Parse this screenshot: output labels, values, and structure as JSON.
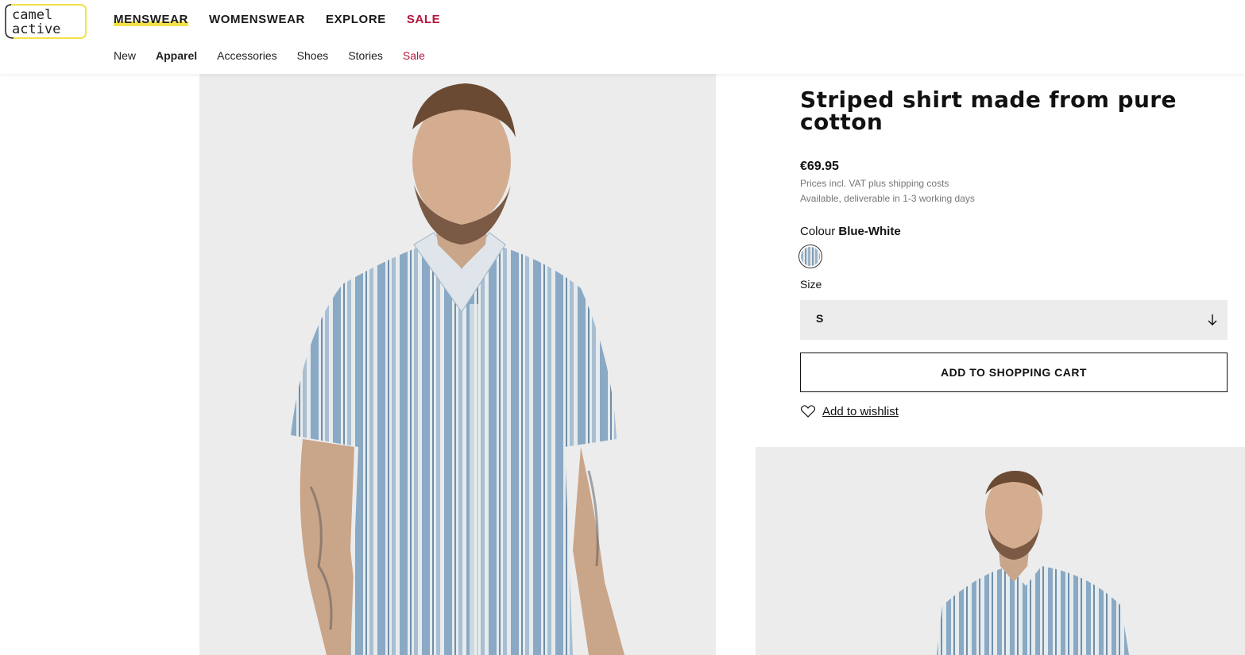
{
  "brand": {
    "logo_line1": "camel",
    "logo_line2": "active",
    "accent": "#f2e24a"
  },
  "main_nav": [
    {
      "label": "MENSWEAR",
      "active": true
    },
    {
      "label": "WOMENSWEAR"
    },
    {
      "label": "EXPLORE"
    },
    {
      "label": "SALE",
      "sale": true
    }
  ],
  "sub_nav": [
    {
      "label": "New"
    },
    {
      "label": "Apparel",
      "active": true
    },
    {
      "label": "Accessories"
    },
    {
      "label": "Shoes"
    },
    {
      "label": "Stories"
    },
    {
      "label": "Sale",
      "sale": true
    }
  ],
  "product": {
    "title": "Striped shirt made from pure cotton",
    "price": "€69.95",
    "price_note": "Prices incl. VAT plus shipping costs",
    "availability": "Available, deliverable in 1-3 working days",
    "colour_label": "Colour",
    "colour_value": "Blue-White",
    "size_label": "Size",
    "size_value": "S",
    "add_to_cart": "ADD TO SHOPPING CART",
    "wishlist": "Add to wishlist"
  },
  "colors": {
    "sale": "#b3163a",
    "image_bg": "#ececec",
    "shirt_blue": "#8aa9c4"
  },
  "icons": {
    "size_dropdown": "arrow-down-icon",
    "wishlist": "heart-icon"
  }
}
